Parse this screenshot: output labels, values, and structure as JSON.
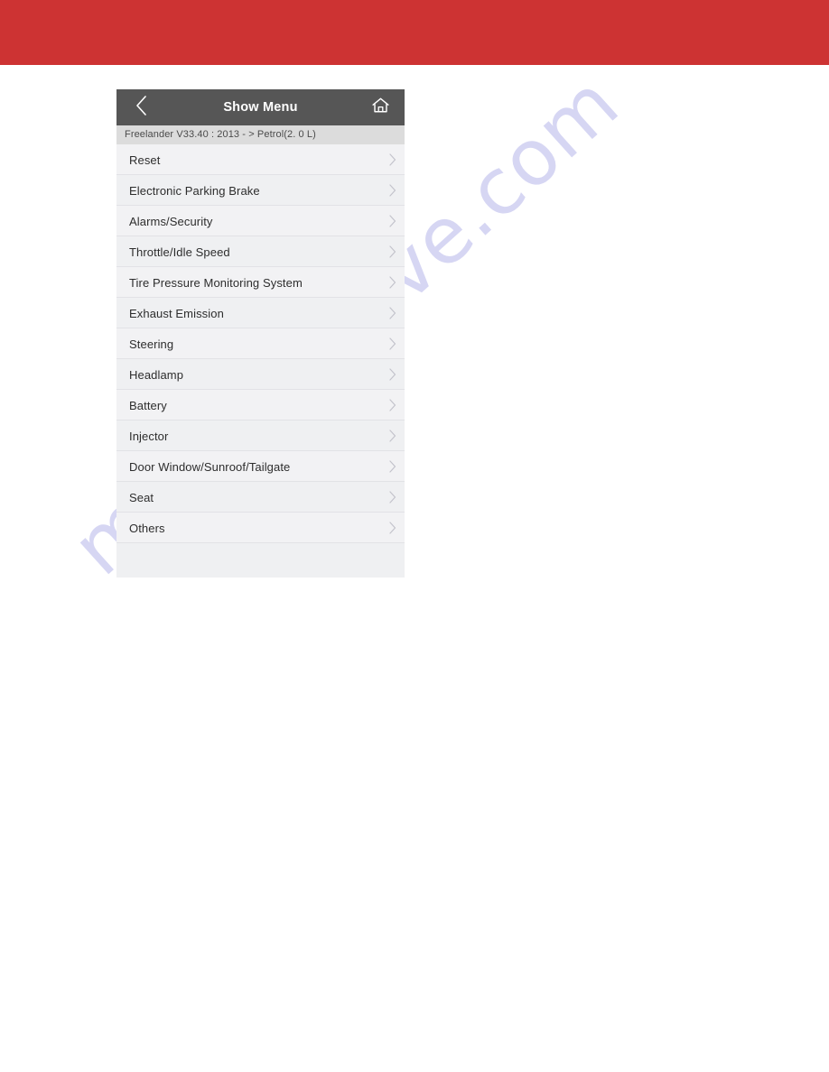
{
  "colors": {
    "banner_red": "#cd3333",
    "header_gray": "#565656",
    "vehicle_bar_gray": "#dcdcdc",
    "list_bg": "#f2f2f4",
    "row_alt_bg": "#eff0f2",
    "separator": "#e2e2e6",
    "label_text": "#2d2d2d",
    "chevron": "#c3c3cb",
    "watermark": "#c9c9ef"
  },
  "banner": {
    "name": "top-red-banner"
  },
  "watermark": {
    "text": "manualshive.com"
  },
  "header": {
    "title": "Show Menu",
    "back_icon": "chevron-left-icon",
    "home_icon": "home-icon"
  },
  "vehicle": {
    "info": "Freelander V33.40 : 2013 - > Petrol(2. 0 L)"
  },
  "menu": {
    "chevron_icon": "chevron-right-icon",
    "items": [
      {
        "label": "Reset"
      },
      {
        "label": "Electronic Parking Brake"
      },
      {
        "label": "Alarms/Security"
      },
      {
        "label": "Throttle/Idle Speed"
      },
      {
        "label": "Tire Pressure Monitoring System"
      },
      {
        "label": "Exhaust Emission"
      },
      {
        "label": "Steering"
      },
      {
        "label": "Headlamp"
      },
      {
        "label": "Battery"
      },
      {
        "label": "Injector"
      },
      {
        "label": "Door Window/Sunroof/Tailgate"
      },
      {
        "label": "Seat"
      },
      {
        "label": "Others"
      }
    ]
  }
}
